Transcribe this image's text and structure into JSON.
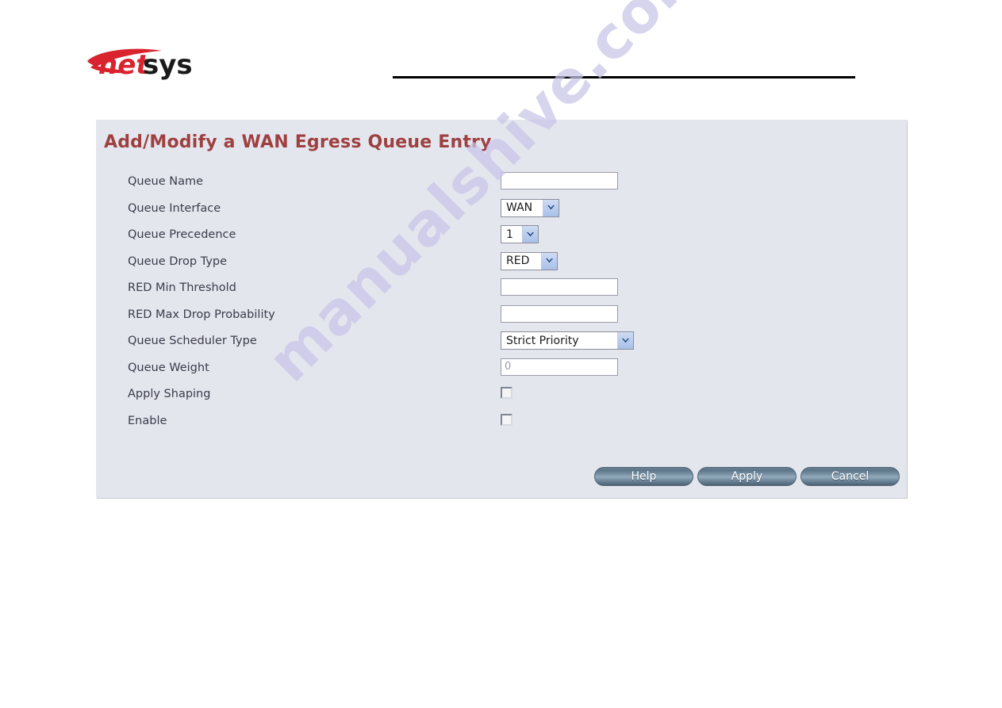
{
  "header": {
    "logo_text_red": "net",
    "logo_text_black": "sys",
    "logo_name": "netsys"
  },
  "panel": {
    "title": "Add/Modify a WAN Egress Queue Entry"
  },
  "form": {
    "rows": [
      {
        "label": "Queue Name",
        "control": "text",
        "value": ""
      },
      {
        "label": "Queue Interface",
        "control": "select",
        "value": "WAN"
      },
      {
        "label": "Queue Precedence",
        "control": "select",
        "value": "1"
      },
      {
        "label": "Queue Drop Type",
        "control": "select",
        "value": "RED"
      },
      {
        "label": "RED Min Threshold",
        "control": "text",
        "value": ""
      },
      {
        "label": "RED Max Drop Probability",
        "control": "text",
        "value": ""
      },
      {
        "label": "Queue Scheduler Type",
        "control": "select",
        "value": "Strict Priority"
      },
      {
        "label": "Queue Weight",
        "control": "text",
        "value": "0"
      },
      {
        "label": "Apply Shaping",
        "control": "checkbox",
        "checked": false
      },
      {
        "label": "Enable",
        "control": "checkbox",
        "checked": false
      }
    ]
  },
  "buttons": {
    "help": "Help",
    "apply": "Apply",
    "cancel": "Cancel"
  },
  "watermark": {
    "text": "manualshive.com"
  },
  "colors": {
    "panel_background": "#e4e6ee",
    "title_text": "#9e4040",
    "label_text": "#3b3b4a",
    "logo_red": "#d9232e",
    "logo_black": "#1a1a1a",
    "button_blue": "#6c8295",
    "watermark": "#c8c4e8",
    "input_border": "#9a9ba9",
    "select_arrow_fill": "#b9cdee"
  }
}
